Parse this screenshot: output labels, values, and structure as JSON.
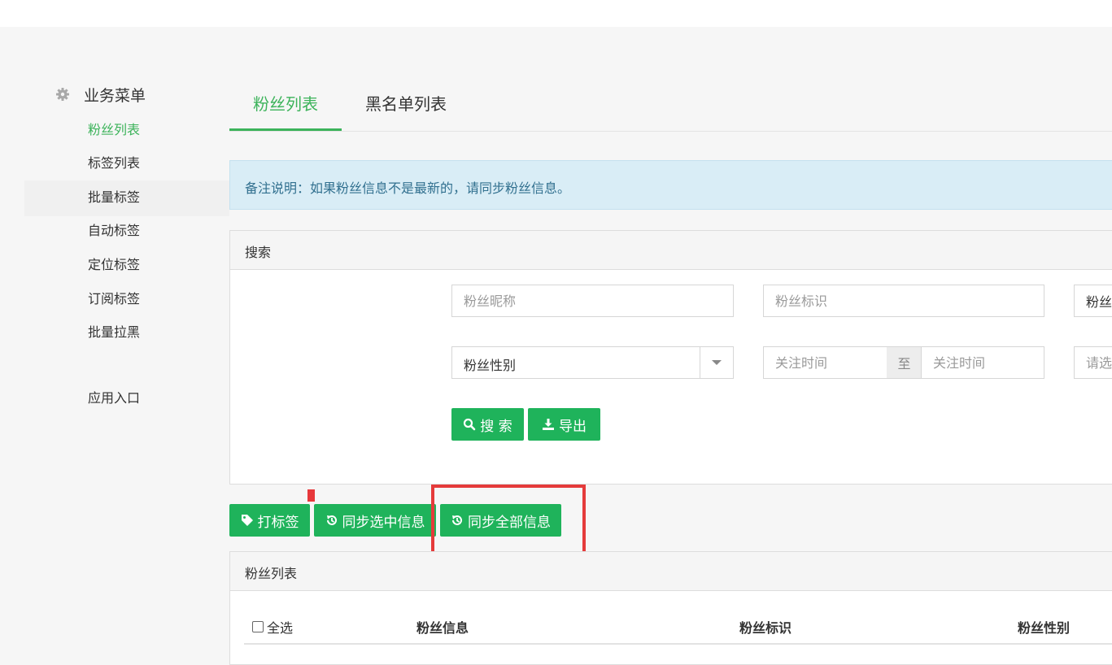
{
  "sidebar": {
    "title": "业务菜单",
    "items": [
      {
        "label": "粉丝列表",
        "active": true
      },
      {
        "label": "标签列表"
      },
      {
        "label": "批量标签"
      },
      {
        "label": "自动标签"
      },
      {
        "label": "定位标签"
      },
      {
        "label": "订阅标签"
      },
      {
        "label": "批量拉黑"
      }
    ],
    "app_entry": "应用入口"
  },
  "tabs": [
    {
      "label": "粉丝列表",
      "active": true
    },
    {
      "label": "黑名单列表"
    }
  ],
  "alert": {
    "text": "备注说明：如果粉丝信息不是最新的，请同步粉丝信息。"
  },
  "search": {
    "title": "搜索",
    "nickname_placeholder": "粉丝昵称",
    "openid_placeholder": "粉丝标识",
    "third_field_value": "粉丝",
    "gender_select_value": "粉丝性别",
    "follow_time_start_placeholder": "关注时间",
    "follow_time_separator": "至",
    "follow_time_end_placeholder": "关注时间",
    "fourth_field_placeholder": "请选",
    "search_button": "搜 索",
    "export_button": "导出"
  },
  "actions": {
    "tag_button": "打标签",
    "sync_selected_button": "同步选中信息",
    "sync_all_button": "同步全部信息"
  },
  "list": {
    "title": "粉丝列表",
    "select_all": "全选",
    "columns": [
      "粉丝信息",
      "粉丝标识",
      "粉丝性别"
    ]
  },
  "colors": {
    "accent_green": "#3cb35a",
    "button_green": "#1fb35b",
    "highlight_red": "#e53b3b",
    "alert_bg": "#d9edf6"
  }
}
